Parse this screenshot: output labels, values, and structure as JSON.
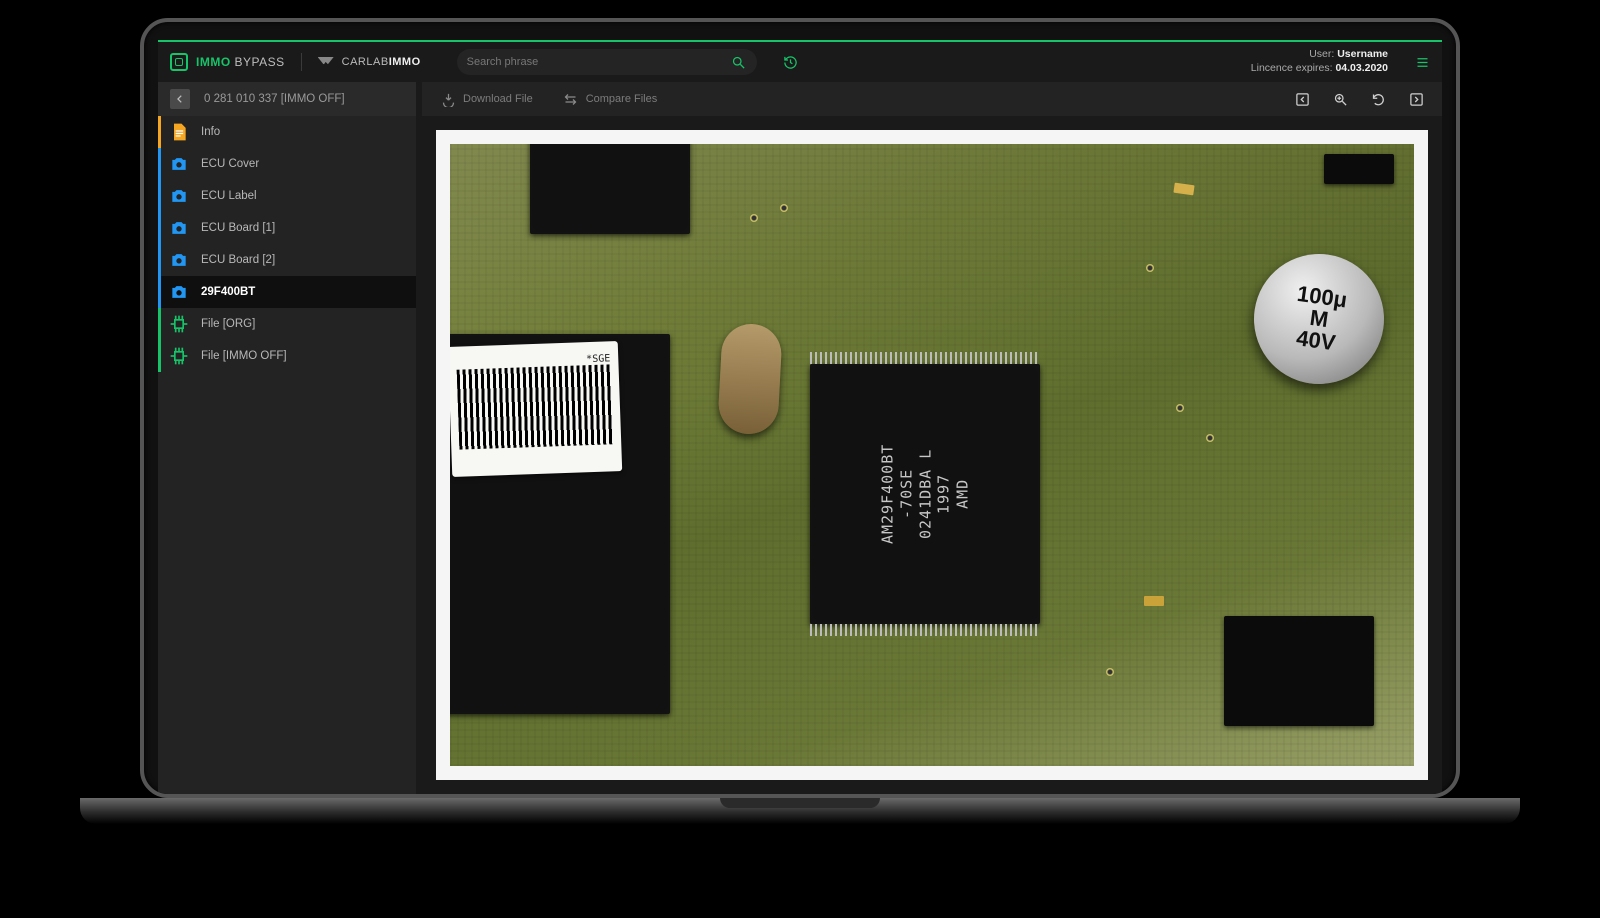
{
  "brand": {
    "immo": "IMMO",
    "bypass": "BYPASS",
    "carlab": "CARLAB",
    "carlab_b": "IMMO"
  },
  "search": {
    "placeholder": "Search phrase"
  },
  "user": {
    "user_label": "User:",
    "username": "Username",
    "lic_label": "Lincence expires:",
    "lic_date": "04.03.2020"
  },
  "crumb": {
    "title": "0 281 010 337 [IMMO OFF]"
  },
  "side": {
    "info": "Info",
    "ecu_cover": "ECU Cover",
    "ecu_label": "ECU Label",
    "ecu_board1": "ECU Board [1]",
    "ecu_board2": "ECU Board [2]",
    "chip": "29F400BT",
    "file_org": "File [ORG]",
    "file_off": "File [IMMO OFF]"
  },
  "toolbar": {
    "download": "Download File",
    "compare": "Compare Files"
  },
  "chip_label": "AM29F400BT\n-70SE\n0241DBA L\n1997\nAMD",
  "cap_label": "100μ\nM\n40V",
  "sticker_txt": "*SGE"
}
